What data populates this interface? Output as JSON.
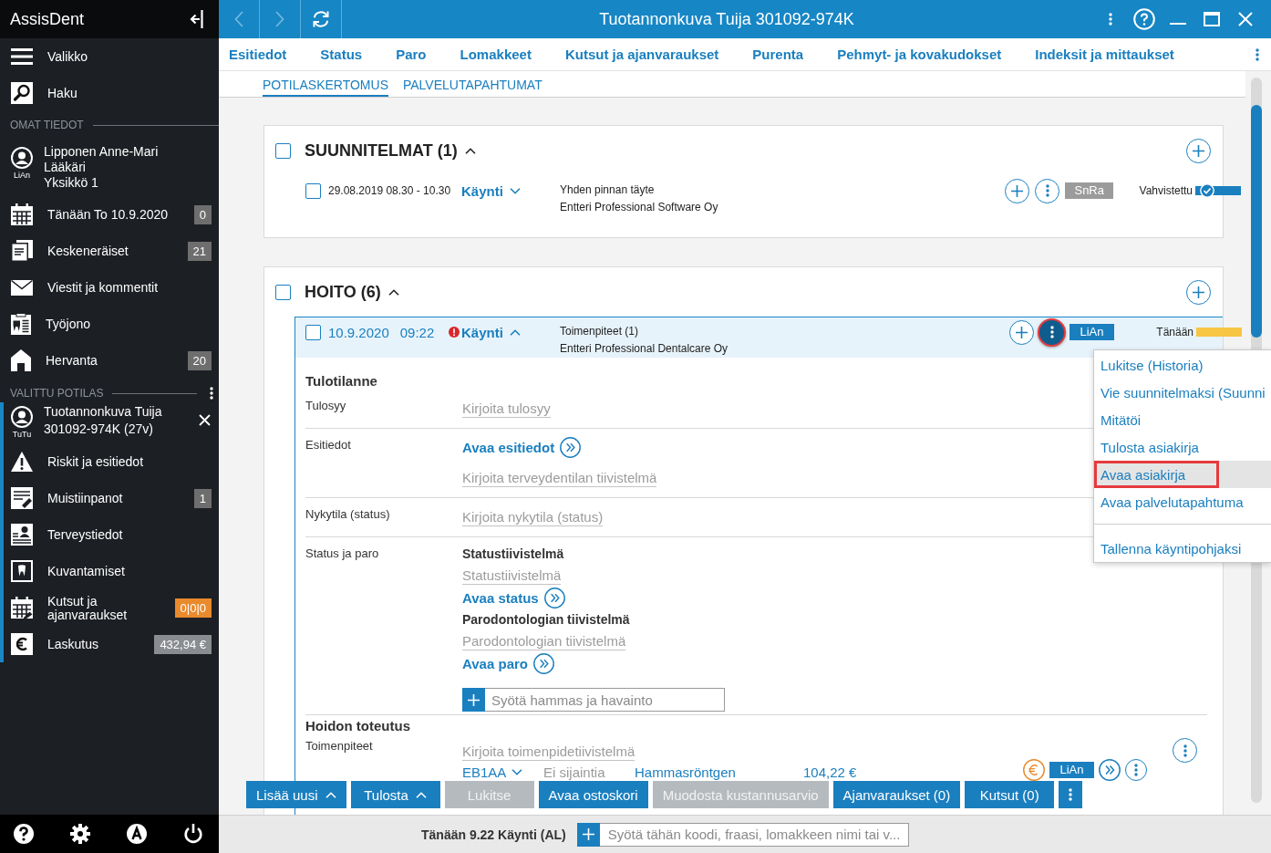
{
  "window": {
    "title": "Tuotannonkuva Tuija 301092-974K",
    "back": {
      "disabled": true
    },
    "forward": {
      "disabled": true
    }
  },
  "sidebar": {
    "app_name": "AssisDent",
    "menu_items": [
      {
        "label": "Valikko"
      },
      {
        "label": "Haku"
      }
    ],
    "my_section": {
      "label": "OMAT TIEDOT",
      "user": {
        "name": "Lipponen Anne-Mari",
        "role": "Lääkäri",
        "unit": "Yksikkö 1",
        "initials": "LiAn"
      },
      "items": [
        {
          "label": "Tänään To 10.9.2020",
          "badge": {
            "text": "0",
            "color": "#6e6e6e"
          }
        },
        {
          "label": "Keskeneräiset",
          "badge": {
            "text": "21",
            "color": "#6e6e6e"
          }
        },
        {
          "label": "Viestit ja kommentit"
        },
        {
          "label": "Työjono"
        },
        {
          "label": "Hervanta",
          "badge": {
            "text": "20",
            "color": "#6e6e6e"
          }
        }
      ]
    },
    "patient_section": {
      "label": "VALITTU POTILAS",
      "patient": {
        "name": "Tuotannonkuva Tuija",
        "id": "301092-974K (27v)",
        "initials": "TuTu"
      },
      "items": [
        {
          "label": "Riskit ja esitiedot"
        },
        {
          "label": "Muistiinpanot",
          "badge": {
            "text": "1",
            "color": "#6e6e6e"
          }
        },
        {
          "label": "Terveystiedot"
        },
        {
          "label": "Kuvantamiset"
        },
        {
          "label": "Kutsut ja ajanvaraukset",
          "badge": {
            "text": "0|0|0",
            "color": "#e98a2c"
          }
        },
        {
          "label": "Laskutus",
          "badge": {
            "text": "432,94 €",
            "color": "#8a8d90"
          }
        }
      ]
    }
  },
  "tabs": [
    {
      "label": "Esitiedot",
      "selected": false
    },
    {
      "label": "Status",
      "selected": false
    },
    {
      "label": "Paro",
      "selected": false
    },
    {
      "label": "Lomakkeet",
      "selected": false
    },
    {
      "label": "Kutsut ja ajanvaraukset",
      "selected": false
    },
    {
      "label": "Purenta",
      "selected": false
    },
    {
      "label": "Pehmyt- ja kovakudokset",
      "selected": false
    },
    {
      "label": "Indeksit ja mittaukset",
      "selected": false
    }
  ],
  "subtabs": [
    {
      "label": "POTILASKERTOMUS",
      "selected": true
    },
    {
      "label": "PALVELUTAPAHTUMAT",
      "selected": false
    }
  ],
  "sections": [
    {
      "title": "SUUNNITELMAT (1)",
      "checked": false,
      "expanded": true,
      "visits": [
        {
          "kind": "plan",
          "checked": false,
          "date": "29.08.2019 08.30 - 10.30",
          "type": "Käynti",
          "expanded": false,
          "lines": [
            "Yhden pinnan täyte",
            "Entteri Professional Software Oy"
          ],
          "badge": {
            "text": "SnRa",
            "color": "#9b9b9b"
          },
          "status": {
            "text": "Vahvistettu",
            "color": "#1a7fbf",
            "confirmed": true
          },
          "menu_open": false
        }
      ]
    },
    {
      "title": "HOITO (6)",
      "checked": false,
      "expanded": true,
      "visits": [
        {
          "kind": "visit",
          "checked": false,
          "date": "10.9.2020",
          "time": "09:22",
          "alert": true,
          "type": "Käynti",
          "expanded": true,
          "lines": [
            "Toimenpiteet (1)",
            "Entteri Professional Dentalcare Oy"
          ],
          "badge": {
            "text": "LiAn",
            "color": "#1a7fbf"
          },
          "status": {
            "text": "Tänään",
            "color": "#f6c644"
          },
          "menu_open": true,
          "menu": [
            {
              "label": "Lukitse (Historia)",
              "highlighted": false
            },
            {
              "label": "Vie suunnitelmaksi (Suunni",
              "highlighted": false
            },
            {
              "label": "Mitätöi",
              "highlighted": false
            },
            {
              "label": "Tulosta asiakirja",
              "highlighted": false
            },
            {
              "label": "Avaa asiakirja",
              "highlighted": true
            },
            {
              "label": "Avaa palvelutapahtuma",
              "highlighted": false
            },
            {
              "label": "Tallenna käyntipohjaksi",
              "highlighted": false,
              "separator_before": true
            }
          ],
          "intake": {
            "heading": "Tulotilanne",
            "rows": [
              {
                "kind": "field",
                "label": "Tulosyy",
                "placeholder": "Kirjoita tulosyy"
              },
              {
                "kind": "link_field",
                "label": "Esitiedot",
                "link": "Avaa esitiedot",
                "placeholder": "Kirjoita terveydentilan tiivistelmä"
              },
              {
                "kind": "field",
                "label": "Nykytila (status)",
                "placeholder": "Kirjoita nykytila (status)"
              },
              {
                "kind": "summaries",
                "label": "Status ja paro",
                "summaries": [
                  {
                    "heading": "Statustiivistelmä",
                    "placeholder": "Statustiivistelmä",
                    "link": "Avaa status"
                  },
                  {
                    "heading": "Parodontologian tiivistelmä",
                    "placeholder": "Parodontologian tiivistelmä",
                    "link": "Avaa paro"
                  }
                ],
                "entry": {
                  "placeholder": "Syötä hammas ja havainto"
                }
              }
            ]
          },
          "treatment": {
            "heading": "Hoidon toteutus",
            "label": "Toimenpiteet",
            "placeholder": "Kirjoita toimenpidetiivistelmä",
            "procedures": [
              {
                "code": "EB1AA",
                "location": "Ei sijaintia",
                "name": "Hammasröntgen",
                "price": "104,22 €",
                "user": {
                  "text": "LiAn",
                  "color": "#1a7fbf"
                }
              }
            ]
          }
        }
      ]
    }
  ],
  "action_buttons": [
    {
      "kind": "dropup",
      "label": "Lisää uusi",
      "disabled": false
    },
    {
      "kind": "dropup",
      "label": "Tulosta",
      "disabled": false
    },
    {
      "kind": "plain",
      "label": "Lukitse",
      "disabled": true
    },
    {
      "kind": "plain",
      "label": "Avaa ostoskori",
      "disabled": false
    },
    {
      "kind": "plain",
      "label": "Muodosta kustannusarvio",
      "disabled": true
    },
    {
      "kind": "plain",
      "label": "Ajanvaraukset (0)",
      "disabled": false
    },
    {
      "kind": "plain",
      "label": "Kutsut (0)",
      "disabled": false
    },
    {
      "kind": "more",
      "disabled": false
    }
  ],
  "footer": {
    "status": "Tänään 9.22 Käynti (AL)",
    "command": {
      "placeholder": "Syötä tähän koodi, fraasi, lomakkeen nimi tai v..."
    }
  }
}
